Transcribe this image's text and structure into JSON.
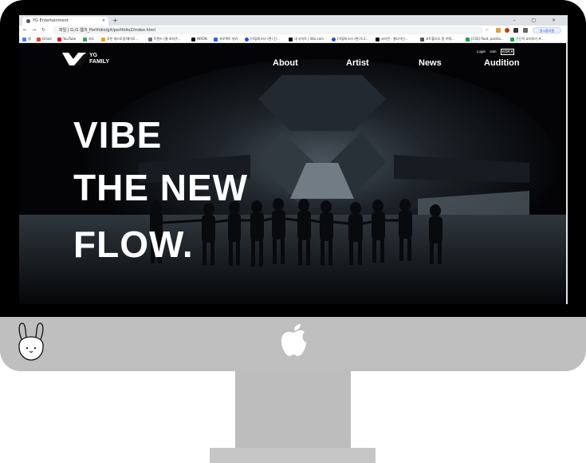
{
  "browser": {
    "tab_title": "YG Entertainment",
    "tab_close": "×",
    "new_tab": "+",
    "window_controls": "– ▢ ×",
    "url": "파일 | G:/1.웹/5_Portfolio/git/portfolio2/index.html",
    "sync_button": "일시중지됨",
    "bookmarks": [
      "앱",
      "Gmail",
      "YouTube",
      "지도",
      "추천 레스토랑/메이로...",
      "트렌드 (웹 포지쿠...",
      "NIXON",
      "프로젝트 위키",
      "[아할피스타 (편) 인...",
      "내 사이트 | Wix.com",
      "[아할피스타 (편) 6.2...",
      "코자전 - 웹디자인...",
      "포트폴리오 잘 이해...",
      "[CSS] float, positio...",
      "간단히 요리하기 프..."
    ]
  },
  "site": {
    "logo_line1": "YG",
    "logo_line2": "FAMILY",
    "login": "Login",
    "join": "Join",
    "language": "KOR ▾",
    "nav": [
      "About",
      "Artist",
      "News",
      "Audition"
    ],
    "headline": [
      "VIBE",
      "THE NEW",
      "FLOW."
    ]
  }
}
